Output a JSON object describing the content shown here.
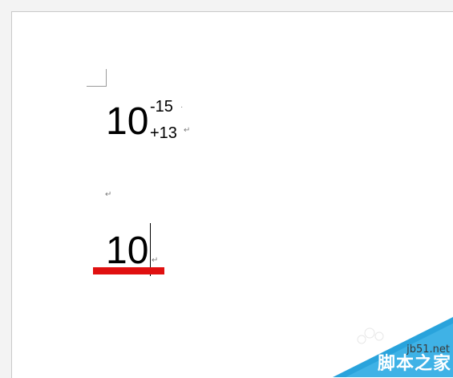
{
  "document": {
    "expression1": {
      "base": "10",
      "superscript": "-15",
      "subscript": "+13"
    },
    "expression2": {
      "base": "10"
    },
    "paragraph_mark": "↵",
    "space_mark": "·"
  },
  "annotation": {
    "underline_color": "#e01010"
  },
  "watermark": {
    "url": "jb51.net",
    "brand": "脚本之家",
    "color": "#29a3dc"
  }
}
